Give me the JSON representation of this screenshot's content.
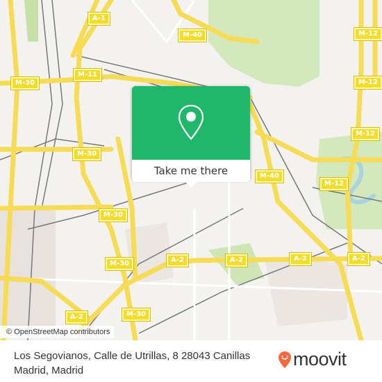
{
  "map": {
    "attribution": "© OpenStreetMap contributors",
    "road_labels": [
      {
        "id": "a1",
        "text": "A-1"
      },
      {
        "id": "m40-top",
        "text": "M-40"
      },
      {
        "id": "m12-top",
        "text": "M-12"
      },
      {
        "id": "m12-mid",
        "text": "M-12"
      },
      {
        "id": "m30-left",
        "text": "M-30"
      },
      {
        "id": "m11",
        "text": "M-11"
      },
      {
        "id": "m30-center",
        "text": "M-30"
      },
      {
        "id": "m12-right",
        "text": "M-12"
      },
      {
        "id": "m40-right",
        "text": "M-40"
      },
      {
        "id": "m12-lower",
        "text": "M-12"
      },
      {
        "id": "m30-a",
        "text": "M-30"
      },
      {
        "id": "m30-b",
        "text": "M-30"
      },
      {
        "id": "a2-a",
        "text": "A-2"
      },
      {
        "id": "a2-b",
        "text": "A-2"
      },
      {
        "id": "a2-c",
        "text": "A-2"
      },
      {
        "id": "a2-d",
        "text": "A-2"
      },
      {
        "id": "m30-c",
        "text": "M-30"
      },
      {
        "id": "a2-e",
        "text": "A-2"
      }
    ],
    "colors": {
      "background": "#f3f2ee",
      "motorway": "#f6dc55",
      "park": "#d4e8bd",
      "rail": "#777777",
      "water": "#aad3df"
    }
  },
  "popup": {
    "icon": "map-pin-icon",
    "button_label": "Take me there",
    "color": "#1fb86b"
  },
  "footer": {
    "address_line1": "Los Segovianos, Calle de Utrillas, 8 28043 Canillas",
    "address_line2": "Madrid, Madrid",
    "brand": "moovit",
    "brand_color": "#f26a3d"
  }
}
